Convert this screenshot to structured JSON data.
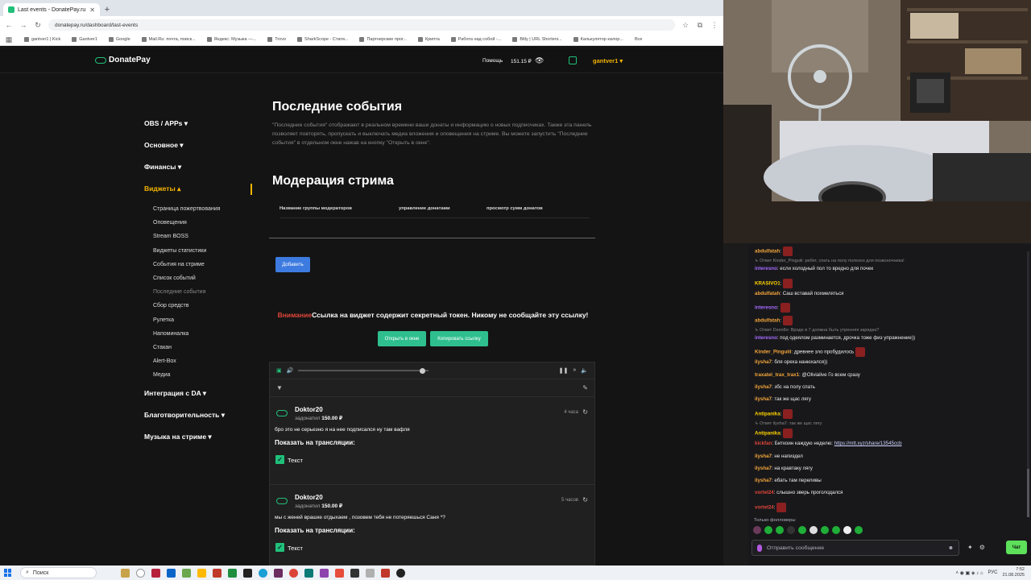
{
  "browser": {
    "tab_title": "Last events - DonatePay.ru",
    "new_tab": "+",
    "url": "donatepay.ru/dashboard/last-events",
    "bookmarks": [
      "gantver1 | Kick",
      "Gantver1",
      "Google",
      "Mail.Ru: почта, поиск...",
      "Яндекс: Музыка —...",
      "Trovo",
      "SharkScope - Стати...",
      "Партнерские прог...",
      "Крипта",
      "Работа над собой -...",
      "Bitly | URL Shorteni...",
      "Калькулятор калор..."
    ],
    "bookmarks_more": "Все"
  },
  "header": {
    "logo": "DonatePay",
    "help": "Помощь",
    "balance": "151.15 ₽",
    "user": "gantver1 ▾"
  },
  "sidebar": {
    "sections": [
      {
        "label": "OBS / APPs ▾"
      },
      {
        "label": "Основное ▾"
      },
      {
        "label": "Финансы ▾"
      },
      {
        "label": "Виджеты ▴"
      }
    ],
    "widget_items": [
      "Страница пожертвования",
      "Оповещения",
      "Stream BOSS",
      "Виджеты статистики",
      "События на стриме",
      "Список событий",
      "Последние события",
      "Сбор средств",
      "Рулетка",
      "Напоминалка",
      "Стакан",
      "Alert-Box",
      "Медиа"
    ],
    "sections_after": [
      "Интеграция с DA ▾",
      "Благотворительность ▾",
      "Музыка на стриме ▾"
    ]
  },
  "main": {
    "title": "Последние события",
    "description": "\"Последние события\" отображают в реальном времени ваши донаты и информацию о новых подписчиках. Также эта панель позволяет повторять, пропускать и выключать медиа вложения и оповещения на стриме. Вы можете запустить \"Последние события\" в отдельном окне нажав на кнопку \"Открыть в окне\".",
    "moderation_title": "Модерация стрима",
    "mod_columns": [
      "Название группы модераторов",
      "управление донатами",
      "просмотр сумм донатов"
    ],
    "add_button": "Добавить",
    "warning_label": "Внимание",
    "warning_text": "Ссылка на виджет содержит секретный токен. Никому не сообщайте эту ссылку!",
    "open_window_button": "Открыть в окне",
    "copy_link_button": "Копировать ссылку",
    "player_progress": 0.95
  },
  "events": [
    {
      "name": "Doktor20",
      "action": "задонатил",
      "amount": "150.00 ₽",
      "time": "4 часа",
      "message": "бро это не серьезно я на нее подписался ну там вафля",
      "show_label": "Показать на трансляции:",
      "check_label": "Текст"
    },
    {
      "name": "Doktor20",
      "action": "задонатил",
      "amount": "150.00 ₽",
      "time": "5 часов",
      "message": "мы с женей врашке отдыхаем , позовем тебя не потеряешься Саня *?",
      "show_label": "Показать на трансляции:",
      "check_label": "Текст"
    }
  ],
  "chat": {
    "messages": [
      {
        "user": "abdulfatah",
        "color": "#f4a63a",
        "text": ":",
        "emote": true
      },
      {
        "reply": "↳ Ответ Kinder_Pinguiii: ребят, спать на полу полезно для позвоночника!"
      },
      {
        "user": "interesno",
        "color": "#a56bff",
        "text": ": если холодный пол то вредно для почек"
      },
      {
        "user": "KRASIVO1",
        "color": "#ffd400",
        "text": ":",
        "emote": true
      },
      {
        "user": "abdulfatah",
        "color": "#f4a63a",
        "text": ": Саш вставай похмеляться"
      },
      {
        "user": "interesno",
        "color": "#a56bff",
        "text": ":",
        "emote": true
      },
      {
        "user": "abdulfatah",
        "color": "#f4a63a",
        "text": ":",
        "emote": true
      },
      {
        "reply": "↳ Ответ Dzen8o: Вроде в 7 должна быть утренняя зарядка?"
      },
      {
        "user": "interesno",
        "color": "#a56bff",
        "text": ": под одеялом разминается, дрочка тоже физ упражнение))"
      },
      {
        "user": "Kinder_Pinguiii",
        "color": "#f4a63a",
        "text": ": древнее зло пробудилось",
        "emote": true
      },
      {
        "user": "ilysha7",
        "color": "#f4a63a",
        "text": ": бля ореха нанюхался))"
      },
      {
        "user": "traxatel_trax_trax1",
        "color": "#f4a63a",
        "text": ": @Olivialive Го всем сразу"
      },
      {
        "user": "ilysha7",
        "color": "#f4a63a",
        "text": ": збс на полу спать"
      },
      {
        "user": "ilysha7",
        "color": "#f4a63a",
        "text": ": так же щас лягу"
      },
      {
        "user": "Antipanika",
        "color": "#ffd400",
        "text": ":",
        "emote": true
      },
      {
        "reply": "↳ Ответ ilysha7: так же щас лягу"
      },
      {
        "user": "Antipanika",
        "color": "#ffd400",
        "text": ":",
        "emote": true
      },
      {
        "user": "kickfan",
        "color": "#e0463a",
        "text": ": Биткоин каждую неделю: ",
        "link": "https://mtt.xyz/share/13545ccb"
      },
      {
        "user": "ilysha7",
        "color": "#f4a63a",
        "text": ": не напиздел"
      },
      {
        "user": "ilysha7",
        "color": "#f4a63a",
        "text": ": на кравтаку лягу"
      },
      {
        "user": "ilysha7",
        "color": "#f4a63a",
        "text": ": ебать там переливы"
      },
      {
        "user": "vortel24",
        "color": "#e0463a",
        "text": ": слышно зверь проголодался"
      },
      {
        "user": "vortel24",
        "color": "#e0463a",
        "text": ":",
        "emote": true
      }
    ],
    "only_followers": "Только фолловеры",
    "input_placeholder": "Отправить сообщение",
    "send_label": "Чат"
  },
  "taskbar": {
    "search_label": "Поиск",
    "lang": "РУС",
    "time": "7:52",
    "date": "21.08.2025"
  }
}
